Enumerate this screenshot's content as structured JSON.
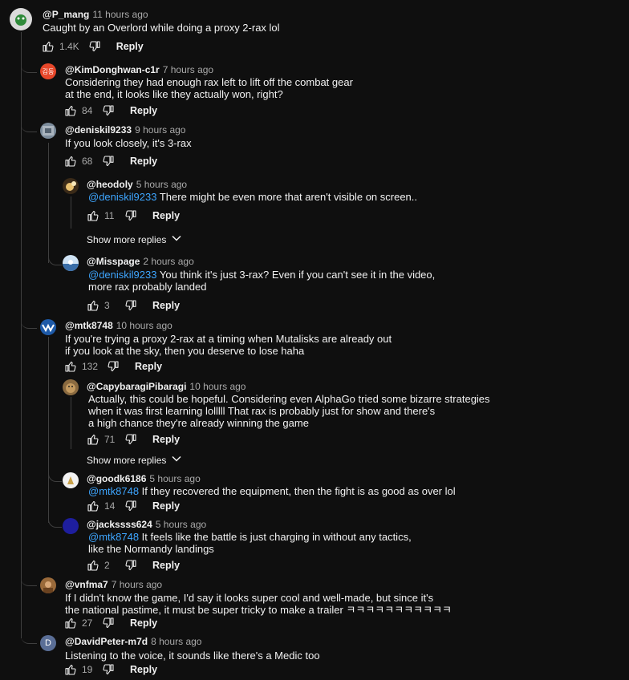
{
  "ui": {
    "reply_label": "Reply",
    "show_more_label": "Show more replies"
  },
  "comments": {
    "c1": {
      "handle": "@P_mang",
      "time": "11 hours ago",
      "line1": "Caught by an Overlord while doing a proxy 2-rax lol",
      "likes": "1.4K"
    },
    "r1": {
      "handle": "@KimDonghwan-c1r",
      "time": "7 hours ago",
      "line1": "Considering they had enough rax left to lift off the combat gear",
      "line2": "at the end, it looks like they actually won, right?",
      "likes": "84",
      "avatar_text": "김동"
    },
    "r2": {
      "handle": "@deniskil9233",
      "time": "9 hours ago",
      "line1": "If you look closely, it's 3-rax",
      "likes": "68"
    },
    "r2a": {
      "handle": "@heodoly",
      "time": "5 hours ago",
      "mention": "@deniskil9233",
      "line1": " There might be even more that aren't visible on screen..",
      "likes": "11"
    },
    "r2b": {
      "handle": "@Misspage",
      "time": "2 hours ago",
      "mention": "@deniskil9233",
      "line1": " You think it's just 3-rax? Even if you can't see it in the video,",
      "line2": "more rax probably landed",
      "likes": "3"
    },
    "r3": {
      "handle": "@mtk8748",
      "time": "10 hours ago",
      "line1": "If you're trying a proxy 2-rax at a timing when Mutalisks are already out",
      "line2": "if you look at the sky, then you deserve to lose haha",
      "likes": "132"
    },
    "r3a": {
      "handle": "@CapybaragiPibaragi",
      "time": "10 hours ago",
      "line1": "Actually, this could be hopeful. Considering even AlphaGo tried some bizarre strategies",
      "line2": "when it was first learning lolllll That rax is probably just for show and there's",
      "line3": "a high chance they're already winning the game",
      "likes": "71"
    },
    "r3b": {
      "handle": "@goodk6186",
      "time": "5 hours ago",
      "mention": "@mtk8748",
      "line1": " If they recovered the equipment, then the fight is as good as over lol",
      "likes": "14"
    },
    "r3c": {
      "handle": "@jackssss624",
      "time": "5 hours ago",
      "mention": "@mtk8748",
      "line1": " It feels like the battle is just charging in without any tactics,",
      "line2": "like the Normandy landings",
      "likes": "2"
    },
    "r4": {
      "handle": "@vnfma7",
      "time": "7 hours ago",
      "line1": "If I didn't know the game, I'd say it looks super cool and well-made, but since it's",
      "line2": "the national pastime, it must be super tricky to make a trailer ㅋㅋㅋㅋㅋㅋㅋㅋㅋㅋㅋ",
      "likes": "27"
    },
    "r5": {
      "handle": "@DavidPeter-m7d",
      "time": "8 hours ago",
      "line1": "Listening to the voice, it sounds like there's a Medic too",
      "likes": "19",
      "avatar_text": "D"
    }
  },
  "colors": {
    "bg": "#0f0f0f",
    "text": "#f1f1f1",
    "muted": "#aaaaaa",
    "mention": "#3ea6ff",
    "thread": "#3f3f3f"
  }
}
